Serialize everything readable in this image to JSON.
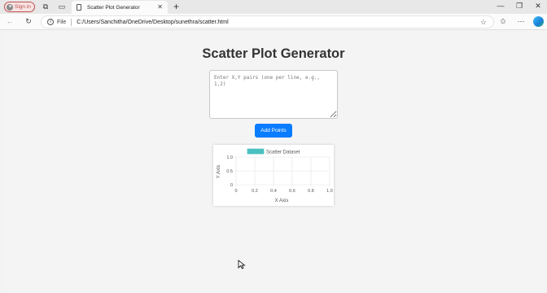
{
  "browser": {
    "signin_label": "Sign in",
    "tab_title": "Scatter Plot Generator",
    "address_scheme": "File",
    "address_url": "C:/Users/Sanchitha/OneDrive/Desktop/sunethra/scatter.html"
  },
  "page": {
    "title": "Scatter Plot Generator",
    "input_placeholder": "Enter X,Y pairs (one per line, e.g., 1,2)",
    "input_value": "",
    "add_button_label": "Add Points"
  },
  "colors": {
    "accent": "#0a7cff",
    "dataset": "#4bc0c0"
  },
  "chart_data": {
    "type": "scatter",
    "series": [
      {
        "name": "Scatter Dataset",
        "points": []
      }
    ],
    "xlabel": "X Axis",
    "ylabel": "Y Axis",
    "xlim": [
      0,
      1
    ],
    "ylim": [
      0,
      1
    ],
    "x_ticks": [
      "0",
      "0.2",
      "0.4",
      "0.6",
      "0.8",
      "1.0"
    ],
    "y_ticks": [
      "0",
      "0.5",
      "1.0"
    ],
    "grid": true,
    "legend_position": "top"
  }
}
